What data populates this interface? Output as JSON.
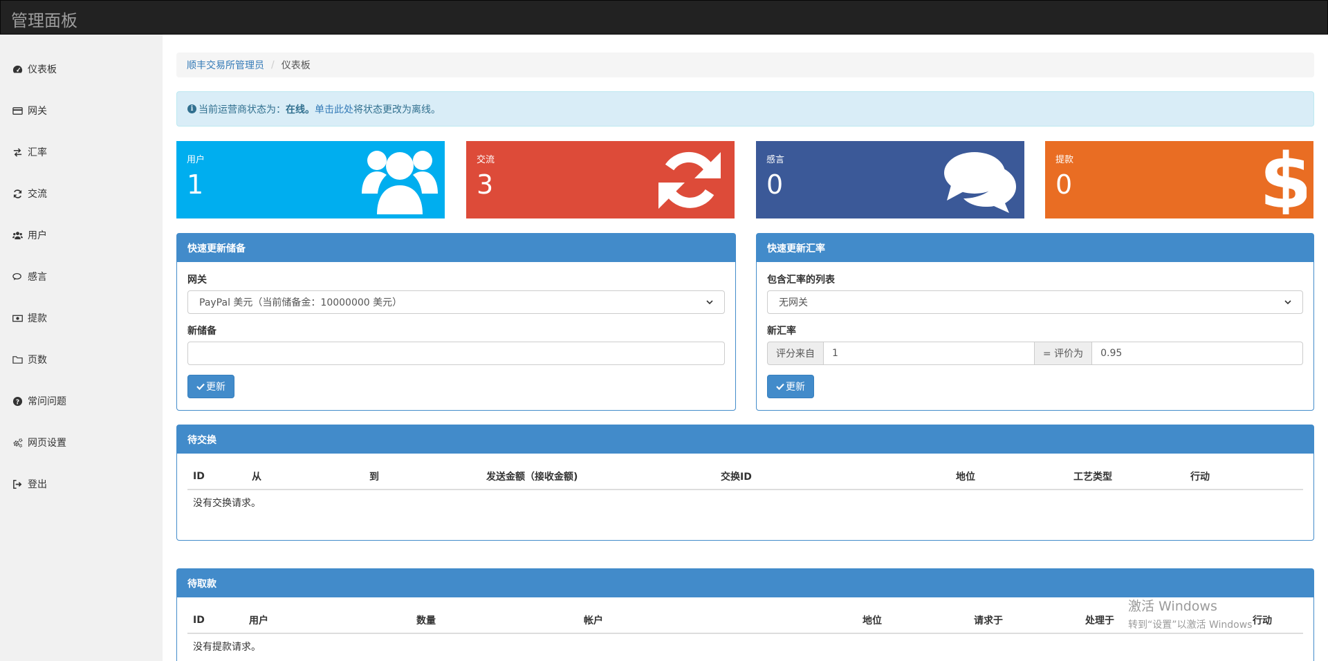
{
  "app": {
    "brand": "管理面板"
  },
  "sidebar": {
    "items": [
      {
        "label": "仪表板",
        "icon": "dashboard-icon"
      },
      {
        "label": "网关",
        "icon": "credit-card-icon"
      },
      {
        "label": "汇率",
        "icon": "exchange-icon"
      },
      {
        "label": "交流",
        "icon": "refresh-icon"
      },
      {
        "label": "用户",
        "icon": "users-icon"
      },
      {
        "label": "感言",
        "icon": "comments-icon"
      },
      {
        "label": "提款",
        "icon": "money-icon"
      },
      {
        "label": "页数",
        "icon": "folder-icon"
      },
      {
        "label": "常问问题",
        "icon": "question-circle-icon"
      },
      {
        "label": "网页设置",
        "icon": "cogs-icon"
      },
      {
        "label": "登出",
        "icon": "sign-out-icon"
      }
    ]
  },
  "breadcrumb": {
    "root": "顺丰交易所管理员",
    "current": "仪表板"
  },
  "alert": {
    "prefix": "当前运营商状态为：",
    "status": "在线。",
    "link": "单击此处",
    "suffix": "将状态更改为离线。"
  },
  "stats": {
    "users": {
      "label": "用户",
      "value": "1",
      "color": "#00aeef",
      "icon": "users-icon"
    },
    "exchanges": {
      "label": "交流",
      "value": "3",
      "color": "#dd4b39",
      "icon": "refresh-icon"
    },
    "testimonials": {
      "label": "感言",
      "value": "0",
      "color": "#3b5998",
      "icon": "comments-icon"
    },
    "withdrawals": {
      "label": "提款",
      "value": "0",
      "color": "#e96d23",
      "icon": "dollar-icon"
    }
  },
  "reserve_panel": {
    "title": "快速更新储备",
    "gateway_label": "网关",
    "gateway_value": "PayPal 美元（当前储备金：10000000 美元）",
    "new_reserve_label": "新储备",
    "new_reserve_value": "",
    "button": "更新"
  },
  "rate_panel": {
    "title": "快速更新汇率",
    "list_label": "包含汇率的列表",
    "list_value": "无网关",
    "new_rate_label": "新汇率",
    "from_addon": "评分来自",
    "from_value": "1",
    "to_addon": "= 评价为",
    "to_value": "0.95",
    "button": "更新"
  },
  "pending_exchanges": {
    "title": "待交换",
    "columns": [
      "ID",
      "从",
      "到",
      "发送金额（接收金额)",
      "交换ID",
      "地位",
      "工艺类型",
      "行动"
    ],
    "empty": "没有交换请求。"
  },
  "pending_withdrawals": {
    "title": "待取款",
    "columns": [
      "ID",
      "用户",
      "数量",
      "帐户",
      "地位",
      "请求于",
      "处理于",
      "行动"
    ],
    "empty": "没有提款请求。"
  },
  "watermark": {
    "line1": "激活 Windows",
    "line2": "转到“设置”以激活 Windows。"
  }
}
